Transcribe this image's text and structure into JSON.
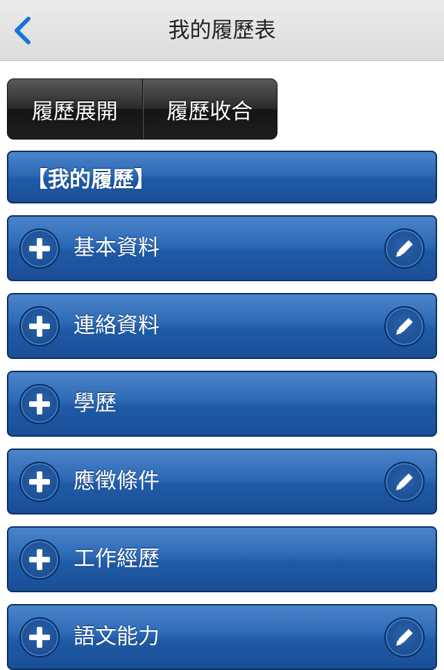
{
  "nav": {
    "title": "我的履歷表",
    "back_icon": "chevron-left-icon"
  },
  "toolbar": {
    "expand_label": "履歷展開",
    "collapse_label": "履歷收合"
  },
  "resume": {
    "header": "【我的履歷】",
    "sections": [
      {
        "label": "基本資料",
        "editable": true
      },
      {
        "label": "連絡資料",
        "editable": true
      },
      {
        "label": "學歷",
        "editable": false
      },
      {
        "label": "應徵條件",
        "editable": true
      },
      {
        "label": "工作經歷",
        "editable": false
      },
      {
        "label": "語文能力",
        "editable": true
      }
    ]
  },
  "colors": {
    "accent_blue": "#2d6ab6",
    "nav_back": "#1a73d9"
  }
}
